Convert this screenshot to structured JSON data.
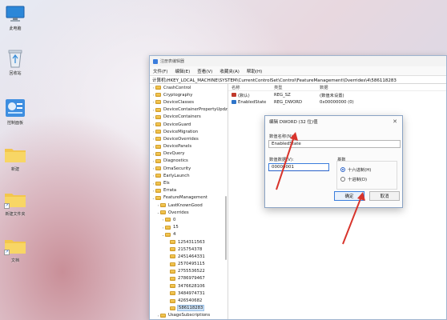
{
  "desktop": {
    "icons": [
      {
        "label": "此电脑",
        "icon": "monitor-icon"
      },
      {
        "label": "回收站",
        "icon": "recycle-bin-icon"
      },
      {
        "label": "控制面板",
        "icon": "control-panel-icon"
      },
      {
        "label": "新建",
        "icon": "folder-icon"
      },
      {
        "label": "新建文件夹",
        "icon": "folder-icon"
      },
      {
        "label": "文档",
        "icon": "folder-icon"
      }
    ]
  },
  "registry": {
    "title": "注册表编辑器",
    "menu": [
      "文件(F)",
      "编辑(E)",
      "查看(V)",
      "收藏夹(A)",
      "帮助(H)"
    ],
    "address": "计算机\\HKEY_LOCAL_MACHINE\\SYSTEM\\CurrentControlSet\\Control\\FeatureManagement\\Overrides\\4\\586118283",
    "tree": [
      {
        "name": "CrashControl",
        "level": 0,
        "chev": "›"
      },
      {
        "name": "Cryptography",
        "level": 0,
        "chev": "›"
      },
      {
        "name": "DeviceClasses",
        "level": 0,
        "chev": "›"
      },
      {
        "name": "DeviceContainerPropertyUpdz",
        "level": 0,
        "chev": "›"
      },
      {
        "name": "DeviceContainers",
        "level": 0,
        "chev": "›"
      },
      {
        "name": "DeviceGuard",
        "level": 0,
        "chev": "›"
      },
      {
        "name": "DeviceMigration",
        "level": 0,
        "chev": "›"
      },
      {
        "name": "DeviceOverrides",
        "level": 0,
        "chev": "›"
      },
      {
        "name": "DevicePanels",
        "level": 0,
        "chev": "›"
      },
      {
        "name": "DevQuery",
        "level": 0,
        "chev": "›"
      },
      {
        "name": "Diagnostics",
        "level": 0,
        "chev": "›"
      },
      {
        "name": "DmaSecurity",
        "level": 0,
        "chev": "›"
      },
      {
        "name": "EarlyLaunch",
        "level": 0,
        "chev": "›"
      },
      {
        "name": "Els",
        "level": 0,
        "chev": "›"
      },
      {
        "name": "Errata",
        "level": 0,
        "chev": "›"
      },
      {
        "name": "FeatureManagement",
        "level": 0,
        "chev": "⌄"
      },
      {
        "name": "LastKnownGood",
        "level": 1,
        "chev": "›"
      },
      {
        "name": "Overrides",
        "level": 1,
        "chev": "⌄"
      },
      {
        "name": "0",
        "level": 2,
        "chev": "›"
      },
      {
        "name": "15",
        "level": 2,
        "chev": "›"
      },
      {
        "name": "4",
        "level": 2,
        "chev": "⌄"
      },
      {
        "name": "1254311563",
        "level": 3,
        "chev": ""
      },
      {
        "name": "215754378",
        "level": 3,
        "chev": ""
      },
      {
        "name": "2451464331",
        "level": 3,
        "chev": ""
      },
      {
        "name": "2570495115",
        "level": 3,
        "chev": ""
      },
      {
        "name": "2755536522",
        "level": 3,
        "chev": ""
      },
      {
        "name": "2786979467",
        "level": 3,
        "chev": ""
      },
      {
        "name": "3476628106",
        "level": 3,
        "chev": ""
      },
      {
        "name": "3484974731",
        "level": 3,
        "chev": ""
      },
      {
        "name": "426540682",
        "level": 3,
        "chev": ""
      },
      {
        "name": "586118283",
        "level": 3,
        "chev": "",
        "selected": true
      },
      {
        "name": "UsageSubscriptions",
        "level": 1,
        "chev": "›"
      }
    ],
    "columns": {
      "name": "名称",
      "type": "类型",
      "data": "数据"
    },
    "values": [
      {
        "name": "(默认)",
        "type": "REG_SZ",
        "data": "(数值未设置)",
        "icon": "sz"
      },
      {
        "name": "EnabledState",
        "type": "REG_DWORD",
        "data": "0x00000000 (0)",
        "icon": "dw"
      }
    ]
  },
  "dialog": {
    "title": "编辑 DWORD (32 位)值",
    "name_label": "数值名称(N):",
    "name_value": "EnabledState",
    "data_label": "数值数据(V):",
    "data_value": "00000001",
    "base_label": "基数",
    "radio_hex": "十六进制(H)",
    "radio_dec": "十进制(D)",
    "ok": "确定",
    "cancel": "取消",
    "close": "✕"
  },
  "colors": {
    "accent": "#2a62c9",
    "annotation": "#d8342c"
  }
}
